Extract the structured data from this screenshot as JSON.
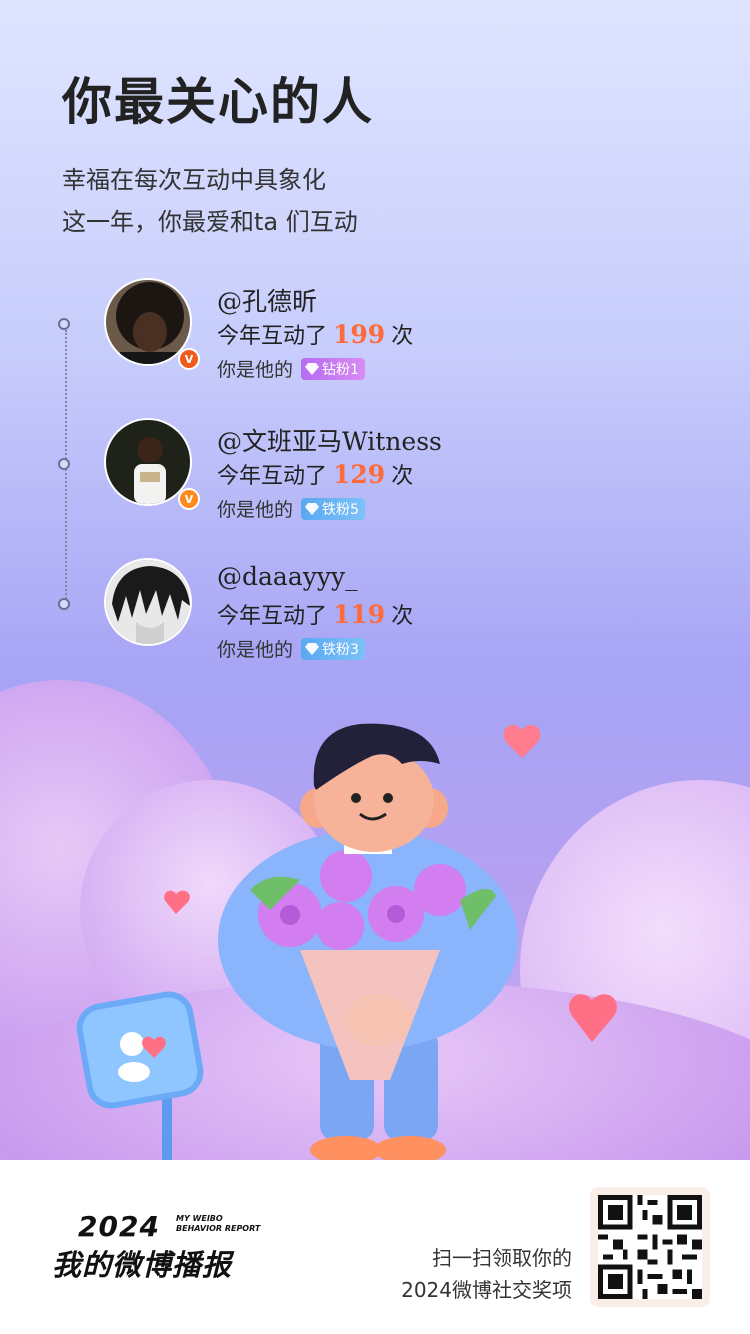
{
  "header": {
    "title": "你最关心的人",
    "subtitle_line1": "幸福在每次互动中具象化",
    "subtitle_line2": "这一年，你最爱和ta 们互动"
  },
  "users": [
    {
      "name": "@孔德昕",
      "count_prefix": "今年互动了",
      "count": "199",
      "count_suffix": "次",
      "relation": "你是他的",
      "fan_tag": "钻粉1",
      "tag_type": "diamond",
      "verify_color": "#f05a1c"
    },
    {
      "name": "@文班亚马Witness",
      "count_prefix": "今年互动了",
      "count": "129",
      "count_suffix": "次",
      "relation": "你是他的",
      "fan_tag": "铁粉5",
      "tag_type": "iron",
      "verify_color": "#ff8a1e"
    },
    {
      "name": "@daaayyy_",
      "count_prefix": "今年互动了",
      "count": "119",
      "count_suffix": "次",
      "relation": "你是他的",
      "fan_tag": "铁粉3",
      "tag_type": "iron",
      "verify_color": ""
    }
  ],
  "footer": {
    "brand_year": "2024",
    "brand_en_line1": "MY WEIBO",
    "brand_en_line2": "BEHAVIOR REPORT",
    "brand_cn": "我的微博播报",
    "scan_line1": "扫一扫领取你的",
    "scan_line2": "2024微博社交奖项"
  },
  "colors": {
    "accent_number": "#ff6a3a",
    "diamond_tag": "#c078f2",
    "iron_tag": "#64b0f4"
  }
}
